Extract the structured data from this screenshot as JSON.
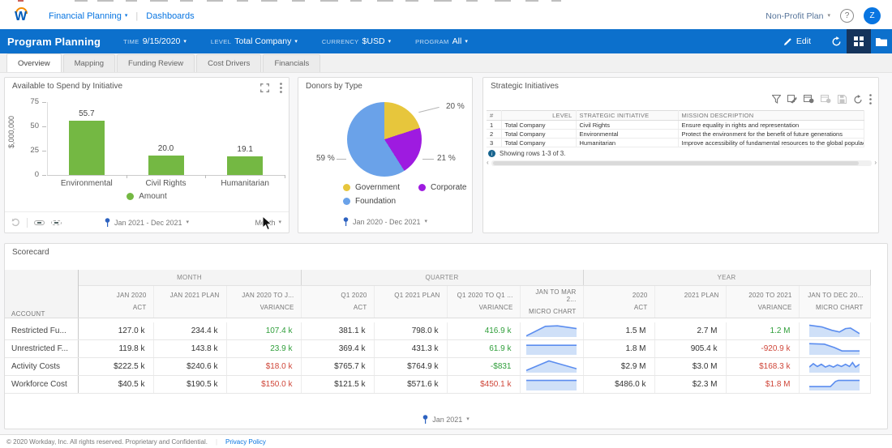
{
  "topbar": {
    "logo_letter": "W",
    "app_menu": "Financial Planning",
    "breadcrumb": "Dashboards",
    "plan_selector": "Non-Profit Plan",
    "help_glyph": "?",
    "avatar_initial": "Z"
  },
  "bluebar": {
    "title": "Program Planning",
    "filters": [
      {
        "label": "TIME",
        "value": "9/15/2020"
      },
      {
        "label": "LEVEL",
        "value": "Total Company"
      },
      {
        "label": "CURRENCY",
        "value": "$USD"
      },
      {
        "label": "PROGRAM",
        "value": "All"
      }
    ],
    "edit_label": "Edit",
    "icons": [
      "pencil-icon",
      "refresh-icon",
      "grid-icon",
      "folder-icon"
    ]
  },
  "tabs": {
    "items": [
      "Overview",
      "Mapping",
      "Funding Review",
      "Cost Drivers",
      "Financials"
    ],
    "active": "Overview"
  },
  "chart_data": [
    {
      "type": "bar",
      "title": "Available to Spend by Initiative",
      "categories": [
        "Environmental",
        "Civil Rights",
        "Humanitarian"
      ],
      "values": [
        55.7,
        20.0,
        19.1
      ],
      "value_labels": [
        "55.7",
        "20.0",
        "19.1"
      ],
      "series_name": "Amount",
      "ylabel": "$,000,000",
      "ylim": [
        0,
        75
      ],
      "yticks": [
        0,
        25,
        50,
        75
      ],
      "bar_color": "#74b843",
      "legend_position": "bottom",
      "time_range": "Jan 2021 - Dec 2021",
      "granularity": "Month"
    },
    {
      "type": "pie",
      "title": "Donors by Type",
      "labels": [
        "Government",
        "Corporate",
        "Foundation"
      ],
      "values": [
        20,
        21,
        59
      ],
      "pct_labels": [
        "20 %",
        "21 %",
        "59 %"
      ],
      "colors": [
        "#e7c63c",
        "#9e1be0",
        "#6aa2e9"
      ],
      "legend_position": "bottom",
      "time_range": "Jan 2020 - Dec 2021"
    }
  ],
  "initiatives": {
    "title": "Strategic Initiatives",
    "toolbar_icons": [
      "filter-icon",
      "table-edit-icon",
      "table-settings-icon",
      "table-remove-icon",
      "save-icon",
      "refresh-icon",
      "kebab-icon"
    ],
    "columns": [
      "#",
      "LEVEL",
      "STRATEGIC INITIATIVE",
      "MISSION DESCRIPTION"
    ],
    "rows": [
      [
        "1",
        "Total Company",
        "Civil Rights",
        "Ensure equality in rights and representation"
      ],
      [
        "2",
        "Total Company",
        "Environmental",
        "Protect the environment for the benefit of future generations"
      ],
      [
        "3",
        "Total Company",
        "Humanitarian",
        "Improve accessibility of fundamental resources to the global populace"
      ]
    ],
    "status": "Showing rows 1-3 of 3."
  },
  "scorecard": {
    "title": "Scorecard",
    "account_header": "ACCOUNT",
    "groups": [
      {
        "label": "MONTH",
        "span": 3
      },
      {
        "label": "QUARTER",
        "span": 4
      },
      {
        "label": "YEAR",
        "span": 4
      }
    ],
    "columns": [
      {
        "l1": "JAN 2020",
        "l2": "ACT"
      },
      {
        "l1": "JAN 2021 PLAN",
        "l2": ""
      },
      {
        "l1": "JAN 2020 TO J...",
        "l2": "VARIANCE"
      },
      {
        "l1": "Q1 2020",
        "l2": "ACT"
      },
      {
        "l1": "Q1 2021 PLAN",
        "l2": ""
      },
      {
        "l1": "Q1 2020 TO Q1 ...",
        "l2": "VARIANCE"
      },
      {
        "l1": "JAN TO MAR 2...",
        "l2": "MICRO CHART"
      },
      {
        "l1": "2020",
        "l2": "ACT"
      },
      {
        "l1": "2021 PLAN",
        "l2": ""
      },
      {
        "l1": "2020 TO 2021",
        "l2": "VARIANCE"
      },
      {
        "l1": "JAN TO DEC 20...",
        "l2": "MICRO CHART"
      }
    ],
    "rows": [
      {
        "account": "Restricted Fu...",
        "cells": [
          {
            "v": "127.0 k"
          },
          {
            "v": "234.4 k"
          },
          {
            "v": "107.4 k",
            "c": "green"
          },
          {
            "v": "381.1 k"
          },
          {
            "v": "798.0 k"
          },
          {
            "v": "416.9 k",
            "c": "green"
          },
          {
            "spark": "r1q"
          },
          {
            "v": "1.5 M"
          },
          {
            "v": "2.7 M"
          },
          {
            "v": "1.2 M",
            "c": "green"
          },
          {
            "spark": "r1y"
          }
        ]
      },
      {
        "account": "Unrestricted F...",
        "cells": [
          {
            "v": "119.8 k"
          },
          {
            "v": "143.8 k"
          },
          {
            "v": "23.9 k",
            "c": "green"
          },
          {
            "v": "369.4 k"
          },
          {
            "v": "431.3 k"
          },
          {
            "v": "61.9 k",
            "c": "green"
          },
          {
            "spark": "r2q"
          },
          {
            "v": "1.8 M"
          },
          {
            "v": "905.4 k"
          },
          {
            "v": "-920.9 k",
            "c": "red"
          },
          {
            "spark": "r2y"
          }
        ]
      },
      {
        "account": "Activity Costs",
        "cells": [
          {
            "v": "$222.5 k"
          },
          {
            "v": "$240.6 k"
          },
          {
            "v": "$18.0 k",
            "c": "red"
          },
          {
            "v": "$765.7 k"
          },
          {
            "v": "$764.9 k"
          },
          {
            "v": "-$831",
            "c": "green"
          },
          {
            "spark": "r3q"
          },
          {
            "v": "$2.9 M"
          },
          {
            "v": "$3.0 M"
          },
          {
            "v": "$168.3 k",
            "c": "red"
          },
          {
            "spark": "r3y"
          }
        ]
      },
      {
        "account": "Workforce Cost",
        "cells": [
          {
            "v": "$40.5 k"
          },
          {
            "v": "$190.5 k"
          },
          {
            "v": "$150.0 k",
            "c": "red"
          },
          {
            "v": "$121.5 k"
          },
          {
            "v": "$571.6 k"
          },
          {
            "v": "$450.1 k",
            "c": "red"
          },
          {
            "spark": "r4q"
          },
          {
            "v": "$486.0 k"
          },
          {
            "v": "$2.3 M"
          },
          {
            "v": "$1.8 M",
            "c": "red"
          },
          {
            "spark": "r4y"
          }
        ]
      }
    ],
    "sparklines": {
      "r1q": [
        [
          0,
          24
        ],
        [
          38,
          7
        ],
        [
          62,
          6
        ],
        [
          100,
          11
        ]
      ],
      "r1y": [
        [
          0,
          5
        ],
        [
          25,
          8
        ],
        [
          45,
          14
        ],
        [
          60,
          17
        ],
        [
          72,
          11
        ],
        [
          82,
          10
        ],
        [
          100,
          20
        ]
      ],
      "r2q": [
        [
          0,
          9
        ],
        [
          100,
          9
        ]
      ],
      "r2y": [
        [
          0,
          6
        ],
        [
          30,
          7
        ],
        [
          50,
          13
        ],
        [
          65,
          19
        ],
        [
          100,
          19
        ]
      ],
      "r3q": [
        [
          0,
          22
        ],
        [
          45,
          5
        ],
        [
          100,
          19
        ]
      ],
      "r3y": [
        [
          0,
          16
        ],
        [
          8,
          10
        ],
        [
          16,
          15
        ],
        [
          24,
          11
        ],
        [
          32,
          16
        ],
        [
          40,
          13
        ],
        [
          48,
          16
        ],
        [
          56,
          12
        ],
        [
          64,
          15
        ],
        [
          72,
          11
        ],
        [
          80,
          15
        ],
        [
          86,
          8
        ],
        [
          92,
          16
        ],
        [
          100,
          11
        ]
      ],
      "r4q": [
        [
          0,
          8
        ],
        [
          100,
          8
        ]
      ],
      "r4y": [
        [
          0,
          19
        ],
        [
          42,
          19
        ],
        [
          52,
          10
        ],
        [
          58,
          8
        ],
        [
          100,
          8
        ]
      ]
    },
    "time": "Jan 2021"
  },
  "footer": {
    "copyright": "© 2020 Workday, Inc. All rights reserved. Proprietary and Confidential.",
    "link": "Privacy Policy"
  },
  "colors": {
    "brand_blue": "#0c70cc",
    "link_blue": "#0875e1",
    "bar_green": "#74b843",
    "pie_yellow": "#e7c63c",
    "pie_purple": "#9e1be0",
    "pie_blue": "#6aa2e9",
    "variance_green": "#2f9e3a",
    "variance_red": "#cf4639",
    "spark_stroke": "#5b8def",
    "spark_fill": "#cfe0f8"
  }
}
